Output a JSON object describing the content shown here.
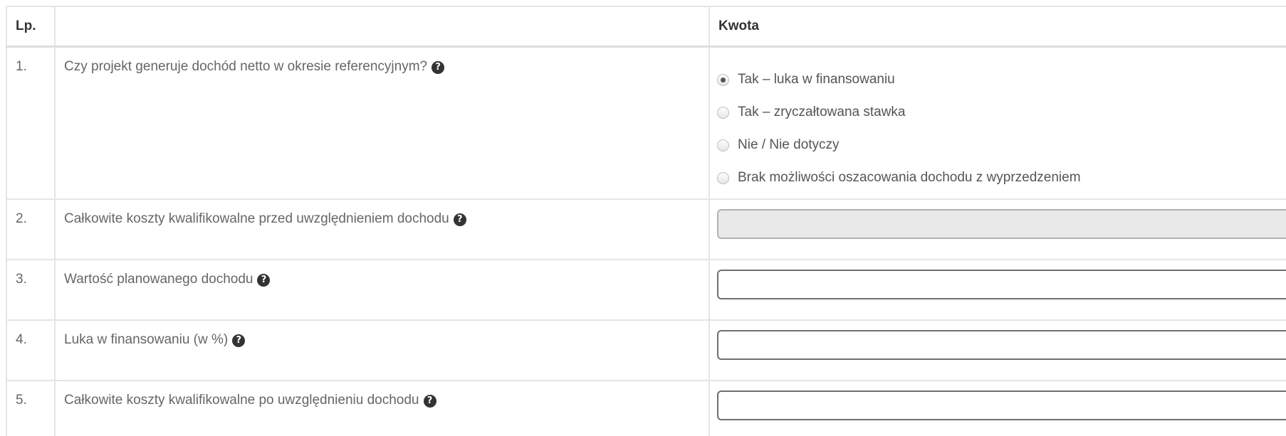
{
  "table": {
    "headers": {
      "lp": "Lp.",
      "description": "",
      "amount": "Kwota"
    },
    "rows": [
      {
        "lp": "1.",
        "label": "Czy projekt generuje dochód netto w okresie referencyjnym?",
        "help_icon": "question-circle-icon",
        "options": [
          {
            "label": "Tak – luka w finansowaniu",
            "selected": true
          },
          {
            "label": "Tak – zryczałtowana stawka",
            "selected": false
          },
          {
            "label": "Nie / Nie dotyczy",
            "selected": false
          },
          {
            "label": "Brak możliwości oszacowania dochodu z wyprzedzeniem",
            "selected": false
          }
        ]
      },
      {
        "lp": "2.",
        "label": "Całkowite koszty kwalifikowalne przed uwzględnieniem dochodu",
        "help_icon": "question-circle-icon",
        "field_value": "",
        "field_disabled": true
      },
      {
        "lp": "3.",
        "label": "Wartość planowanego dochodu",
        "help_icon": "question-circle-icon",
        "field_value": "",
        "field_disabled": false
      },
      {
        "lp": "4.",
        "label": "Luka w finansowaniu (w %)",
        "help_icon": "question-circle-icon",
        "field_value": "",
        "field_disabled": false
      },
      {
        "lp": "5.",
        "label": "Całkowite koszty kwalifikowalne po uwzględnieniu dochodu",
        "help_icon": "question-circle-icon",
        "field_value": "",
        "field_disabled": false
      }
    ]
  },
  "help_icon_glyph": "?"
}
